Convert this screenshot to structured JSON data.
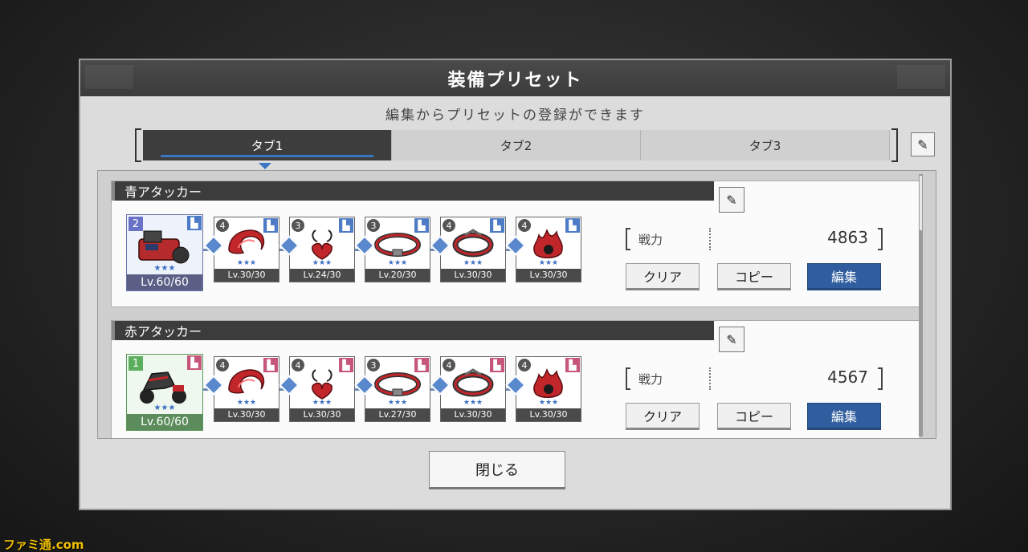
{
  "dialog": {
    "title": "装備プリセット",
    "subtitle": "編集からプリセットの登録ができます",
    "close_label": "閉じる"
  },
  "tabs": [
    {
      "label": "タブ1",
      "active": true
    },
    {
      "label": "タブ2",
      "active": false
    },
    {
      "label": "タブ3",
      "active": false
    }
  ],
  "presets": [
    {
      "name": "青アタッカー",
      "power_label": "戦力",
      "power_value": "4863",
      "buttons": {
        "clear": "クリア",
        "copy": "コピー",
        "edit": "編集"
      },
      "main": {
        "rarity": "2",
        "stars": "★★★",
        "level": "Lv.60/60",
        "color": "blue",
        "type_color": "#4d7bc6"
      },
      "items": [
        {
          "rarity": "4",
          "stars": "★★★",
          "level": "Lv.30/30",
          "icon": "flame-claw-icon"
        },
        {
          "rarity": "3",
          "stars": "★★★",
          "level": "Lv.24/30",
          "icon": "pendant-icon"
        },
        {
          "rarity": "3",
          "stars": "★★★",
          "level": "Lv.20/30",
          "icon": "belt-icon"
        },
        {
          "rarity": "4",
          "stars": "★★★",
          "level": "Lv.30/30",
          "icon": "bracelet-icon"
        },
        {
          "rarity": "4",
          "stars": "★★★",
          "level": "Lv.30/30",
          "icon": "flame-gem-icon"
        }
      ]
    },
    {
      "name": "赤アタッカー",
      "power_label": "戦力",
      "power_value": "4567",
      "buttons": {
        "clear": "クリア",
        "copy": "コピー",
        "edit": "編集"
      },
      "main": {
        "rarity": "1",
        "stars": "★★★",
        "level": "Lv.60/60",
        "color": "green",
        "type_color": "#c7577a"
      },
      "items": [
        {
          "rarity": "4",
          "stars": "★★★",
          "level": "Lv.30/30",
          "icon": "flame-claw-icon"
        },
        {
          "rarity": "4",
          "stars": "★★★",
          "level": "Lv.30/30",
          "icon": "pendant-icon"
        },
        {
          "rarity": "3",
          "stars": "★★★",
          "level": "Lv.27/30",
          "icon": "belt-icon"
        },
        {
          "rarity": "4",
          "stars": "★★★",
          "level": "Lv.30/30",
          "icon": "bracelet-icon"
        },
        {
          "rarity": "4",
          "stars": "★★★",
          "level": "Lv.30/30",
          "icon": "flame-gem-icon"
        }
      ]
    }
  ],
  "watermark": "ファミ通.com"
}
